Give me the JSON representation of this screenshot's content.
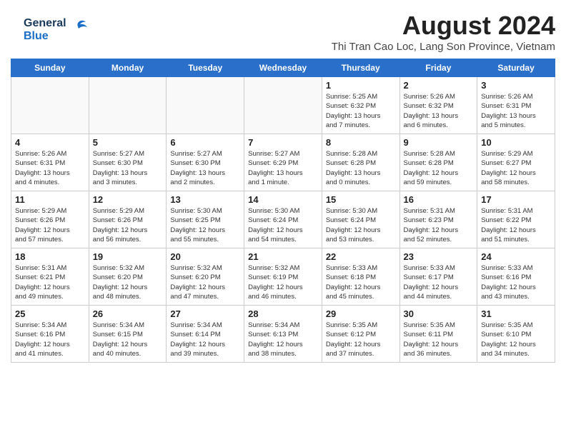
{
  "header": {
    "month_year": "August 2024",
    "location": "Thi Tran Cao Loc, Lang Son Province, Vietnam",
    "logo_line1": "General",
    "logo_line2": "Blue"
  },
  "days_of_week": [
    "Sunday",
    "Monday",
    "Tuesday",
    "Wednesday",
    "Thursday",
    "Friday",
    "Saturday"
  ],
  "weeks": [
    [
      {
        "day": "",
        "info": ""
      },
      {
        "day": "",
        "info": ""
      },
      {
        "day": "",
        "info": ""
      },
      {
        "day": "",
        "info": ""
      },
      {
        "day": "1",
        "info": "Sunrise: 5:25 AM\nSunset: 6:32 PM\nDaylight: 13 hours\nand 7 minutes."
      },
      {
        "day": "2",
        "info": "Sunrise: 5:26 AM\nSunset: 6:32 PM\nDaylight: 13 hours\nand 6 minutes."
      },
      {
        "day": "3",
        "info": "Sunrise: 5:26 AM\nSunset: 6:31 PM\nDaylight: 13 hours\nand 5 minutes."
      }
    ],
    [
      {
        "day": "4",
        "info": "Sunrise: 5:26 AM\nSunset: 6:31 PM\nDaylight: 13 hours\nand 4 minutes."
      },
      {
        "day": "5",
        "info": "Sunrise: 5:27 AM\nSunset: 6:30 PM\nDaylight: 13 hours\nand 3 minutes."
      },
      {
        "day": "6",
        "info": "Sunrise: 5:27 AM\nSunset: 6:30 PM\nDaylight: 13 hours\nand 2 minutes."
      },
      {
        "day": "7",
        "info": "Sunrise: 5:27 AM\nSunset: 6:29 PM\nDaylight: 13 hours\nand 1 minute."
      },
      {
        "day": "8",
        "info": "Sunrise: 5:28 AM\nSunset: 6:28 PM\nDaylight: 13 hours\nand 0 minutes."
      },
      {
        "day": "9",
        "info": "Sunrise: 5:28 AM\nSunset: 6:28 PM\nDaylight: 12 hours\nand 59 minutes."
      },
      {
        "day": "10",
        "info": "Sunrise: 5:29 AM\nSunset: 6:27 PM\nDaylight: 12 hours\nand 58 minutes."
      }
    ],
    [
      {
        "day": "11",
        "info": "Sunrise: 5:29 AM\nSunset: 6:26 PM\nDaylight: 12 hours\nand 57 minutes."
      },
      {
        "day": "12",
        "info": "Sunrise: 5:29 AM\nSunset: 6:26 PM\nDaylight: 12 hours\nand 56 minutes."
      },
      {
        "day": "13",
        "info": "Sunrise: 5:30 AM\nSunset: 6:25 PM\nDaylight: 12 hours\nand 55 minutes."
      },
      {
        "day": "14",
        "info": "Sunrise: 5:30 AM\nSunset: 6:24 PM\nDaylight: 12 hours\nand 54 minutes."
      },
      {
        "day": "15",
        "info": "Sunrise: 5:30 AM\nSunset: 6:24 PM\nDaylight: 12 hours\nand 53 minutes."
      },
      {
        "day": "16",
        "info": "Sunrise: 5:31 AM\nSunset: 6:23 PM\nDaylight: 12 hours\nand 52 minutes."
      },
      {
        "day": "17",
        "info": "Sunrise: 5:31 AM\nSunset: 6:22 PM\nDaylight: 12 hours\nand 51 minutes."
      }
    ],
    [
      {
        "day": "18",
        "info": "Sunrise: 5:31 AM\nSunset: 6:21 PM\nDaylight: 12 hours\nand 49 minutes."
      },
      {
        "day": "19",
        "info": "Sunrise: 5:32 AM\nSunset: 6:20 PM\nDaylight: 12 hours\nand 48 minutes."
      },
      {
        "day": "20",
        "info": "Sunrise: 5:32 AM\nSunset: 6:20 PM\nDaylight: 12 hours\nand 47 minutes."
      },
      {
        "day": "21",
        "info": "Sunrise: 5:32 AM\nSunset: 6:19 PM\nDaylight: 12 hours\nand 46 minutes."
      },
      {
        "day": "22",
        "info": "Sunrise: 5:33 AM\nSunset: 6:18 PM\nDaylight: 12 hours\nand 45 minutes."
      },
      {
        "day": "23",
        "info": "Sunrise: 5:33 AM\nSunset: 6:17 PM\nDaylight: 12 hours\nand 44 minutes."
      },
      {
        "day": "24",
        "info": "Sunrise: 5:33 AM\nSunset: 6:16 PM\nDaylight: 12 hours\nand 43 minutes."
      }
    ],
    [
      {
        "day": "25",
        "info": "Sunrise: 5:34 AM\nSunset: 6:16 PM\nDaylight: 12 hours\nand 41 minutes."
      },
      {
        "day": "26",
        "info": "Sunrise: 5:34 AM\nSunset: 6:15 PM\nDaylight: 12 hours\nand 40 minutes."
      },
      {
        "day": "27",
        "info": "Sunrise: 5:34 AM\nSunset: 6:14 PM\nDaylight: 12 hours\nand 39 minutes."
      },
      {
        "day": "28",
        "info": "Sunrise: 5:34 AM\nSunset: 6:13 PM\nDaylight: 12 hours\nand 38 minutes."
      },
      {
        "day": "29",
        "info": "Sunrise: 5:35 AM\nSunset: 6:12 PM\nDaylight: 12 hours\nand 37 minutes."
      },
      {
        "day": "30",
        "info": "Sunrise: 5:35 AM\nSunset: 6:11 PM\nDaylight: 12 hours\nand 36 minutes."
      },
      {
        "day": "31",
        "info": "Sunrise: 5:35 AM\nSunset: 6:10 PM\nDaylight: 12 hours\nand 34 minutes."
      }
    ]
  ]
}
